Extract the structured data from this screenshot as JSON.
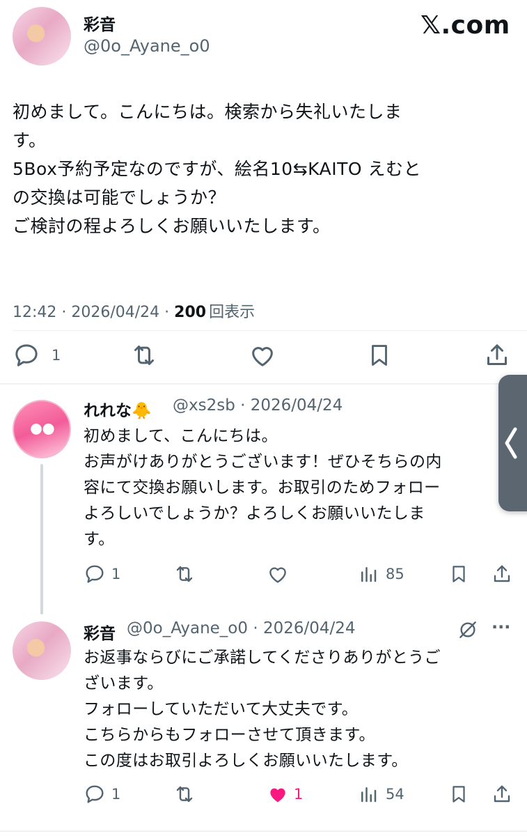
{
  "brand": "𝕏.com",
  "main_post": {
    "author_name": "彩音",
    "author_handle": "@0o_Ayane_o0",
    "lines": [
      "初めまして。こんにちは。検索から失礼いたしま",
      "す。",
      "5Box予約予定なのですが、絵名10⇆KAITO えむと",
      "の交換は可能でしょうか？",
      "ご検討の程よろしくお願いいたします。"
    ],
    "time": "12:42 · 2026/04/24 · ",
    "views_count": "200",
    "views_label": "回表示",
    "reply_count": "1"
  },
  "reply1": {
    "author_name": "れれな🐥",
    "author_handle": "@xs2sb · 2026/04/24",
    "lines": [
      "初めまして、こんにちは。",
      "お声がけありがとうございます！ぜひそちらの内",
      "容にて交換お願いします。お取引のためフォロー",
      "よろしいでしょうか？よろしくお願いいたしま",
      "す。"
    ],
    "reply_count": "1",
    "views_count": "85"
  },
  "reply2": {
    "author_name": "彩音",
    "author_handle": "@0o_Ayane_o0 · 2026/04/24",
    "lines": [
      "お返事ならびにご承諾してくださりありがとうご",
      "ざいます。",
      "フォローしていただいて大丈夫です。",
      "こちらからもフォローさせて頂きます。",
      "この度はお取引よろしくお願いいたします。"
    ],
    "reply_count": "1",
    "like_count": "1",
    "views_count": "54",
    "more": "···"
  },
  "colors": {
    "text": "#0f1419",
    "secondary": "#536471",
    "like_active": "#f91880",
    "side_tab": "#5b6670"
  }
}
